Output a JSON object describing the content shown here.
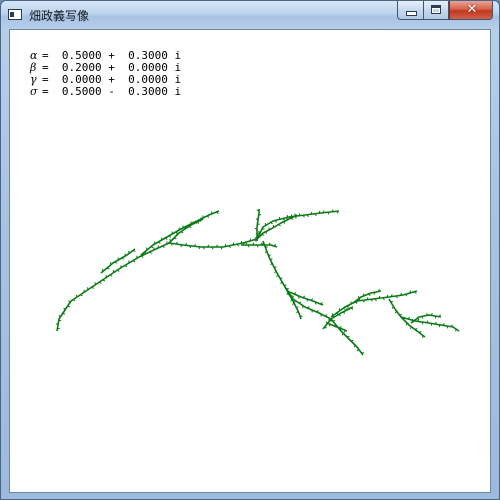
{
  "window": {
    "title": "畑政義写像",
    "buttons": {
      "minimize": "minimize",
      "maximize": "maximize",
      "close": "✕"
    }
  },
  "parameters": [
    {
      "symbol": "α",
      "value": "=  0.5000 +  0.3000 i"
    },
    {
      "symbol": "β",
      "value": "=  0.2000 +  0.0000 i"
    },
    {
      "symbol": "γ",
      "value": "=  0.0000 +  0.0000 i"
    },
    {
      "symbol": "σ",
      "value": "=  0.5000 -  0.3000 i"
    }
  ],
  "colors": {
    "fractal": "#0a7a14",
    "background": "#ffffff"
  },
  "icons": {
    "app": "window-app-icon",
    "minimize": "minimize-icon",
    "maximize": "maximize-icon",
    "close": "close-icon"
  }
}
